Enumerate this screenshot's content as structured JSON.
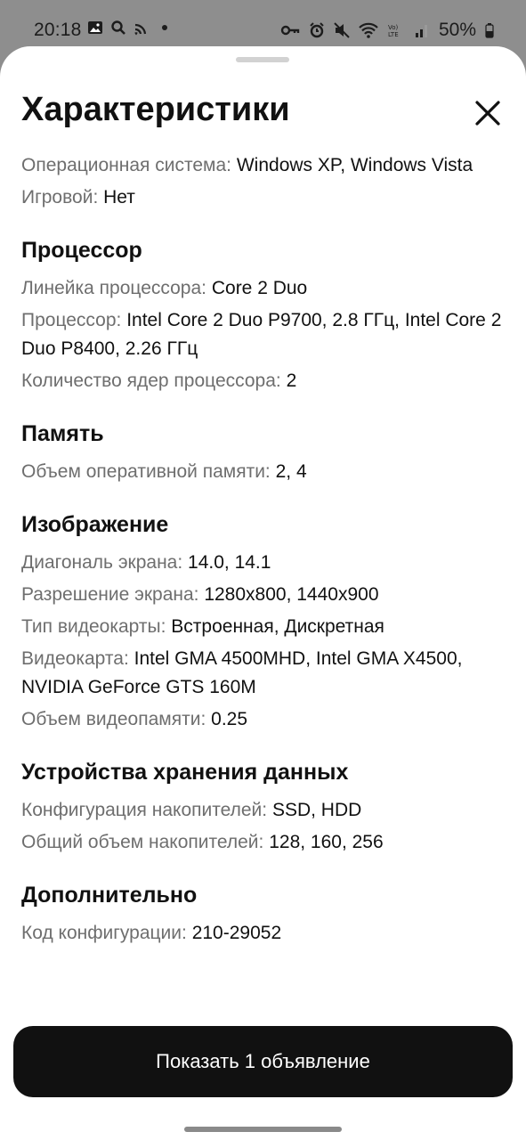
{
  "status_bar": {
    "time": "20:18",
    "battery": "50%",
    "left_icons": [
      "image-icon",
      "search-icon",
      "cast-icon",
      "dot-icon"
    ],
    "right_icons": [
      "key-icon",
      "alarm-icon",
      "mute-icon",
      "wifi-icon",
      "volte-icon",
      "signal-icon",
      "battery-icon"
    ]
  },
  "sheet": {
    "title": "Характеристики",
    "close_icon": "close-icon"
  },
  "sections": [
    {
      "title": "",
      "rows": [
        {
          "label": "Операционная система:",
          "value": "Windows XP, Windows Vista"
        },
        {
          "label": "Игровой:",
          "value": "Нет"
        }
      ]
    },
    {
      "title": "Процессор",
      "rows": [
        {
          "label": "Линейка процессора:",
          "value": "Core 2 Duo"
        },
        {
          "label": "Процессор:",
          "value": "Intel Core 2 Duo P9700, 2.8 ГГц, Intel Core 2 Duo P8400, 2.26 ГГц"
        },
        {
          "label": "Количество ядер процессора:",
          "value": "2"
        }
      ]
    },
    {
      "title": "Память",
      "rows": [
        {
          "label": "Объем оперативной памяти:",
          "value": "2, 4"
        }
      ]
    },
    {
      "title": "Изображение",
      "rows": [
        {
          "label": "Диагональ экрана:",
          "value": "14.0, 14.1"
        },
        {
          "label": "Разрешение экрана:",
          "value": "1280x800, 1440x900"
        },
        {
          "label": "Тип видеокарты:",
          "value": "Встроенная, Дискретная"
        },
        {
          "label": "Видеокарта:",
          "value": "Intel GMA 4500MHD, Intel GMA X4500, NVIDIA GeForce GTS 160M"
        },
        {
          "label": "Объем видеопамяти:",
          "value": "0.25"
        }
      ]
    },
    {
      "title": "Устройства хранения данных",
      "rows": [
        {
          "label": "Конфигурация накопителей:",
          "value": "SSD, HDD"
        },
        {
          "label": "Общий объем накопителей:",
          "value": "128, 160, 256"
        }
      ]
    },
    {
      "title": "Дополнительно",
      "rows": [
        {
          "label": "Код конфигурации:",
          "value": "210-29052"
        }
      ]
    }
  ],
  "footer": {
    "button_label": "Показать 1 объявление"
  },
  "colors": {
    "label": "#6e6e6e",
    "value": "#111111",
    "button_bg": "#111111",
    "button_text": "#ffffff"
  }
}
